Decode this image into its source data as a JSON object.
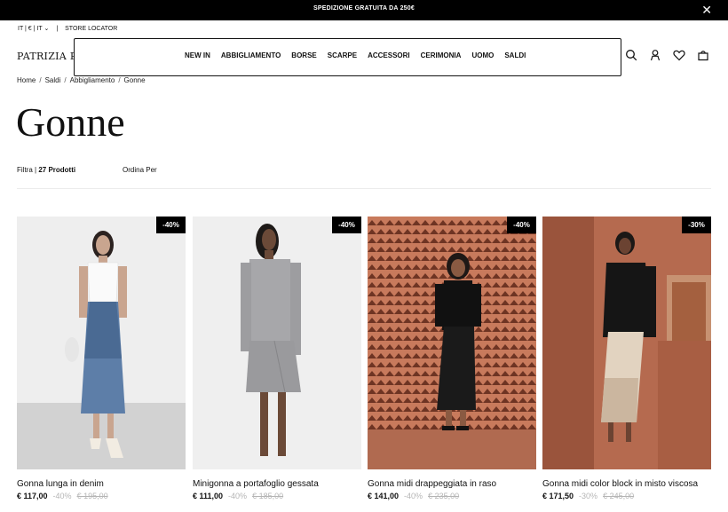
{
  "promo": {
    "text": "SPEDIZIONE GRATUITA DA 250€",
    "close": "✕"
  },
  "locale": {
    "selector": "IT | € | IT ⌄",
    "separator": "|",
    "store_locator": "STORE LOCATOR"
  },
  "brand": {
    "logo": "PATRIZIA PEPE"
  },
  "nav": {
    "items": [
      {
        "label": "NEW IN"
      },
      {
        "label": "ABBIGLIAMENTO"
      },
      {
        "label": "BORSE"
      },
      {
        "label": "SCARPE"
      },
      {
        "label": "ACCESSORI"
      },
      {
        "label": "CERIMONIA"
      },
      {
        "label": "UOMO"
      },
      {
        "label": "SALDI"
      }
    ]
  },
  "header_icons": [
    "search-icon",
    "account-icon",
    "wishlist-heart-icon",
    "shopping-bag-icon"
  ],
  "breadcrumb": [
    {
      "label": "Home"
    },
    {
      "label": "Saldi"
    },
    {
      "label": "Abbigliamento"
    },
    {
      "label": "Gonne"
    }
  ],
  "breadcrumb_separator": "/",
  "page_title": "Gonne",
  "filter": {
    "label": "Filtra",
    "separator": "|",
    "count": "27 Prodotti"
  },
  "sort": {
    "label": "Ordina Per"
  },
  "products": [
    {
      "name": "Gonna lunga in denim",
      "badge": "-40%",
      "price": "€ 117,00",
      "discount": "-40%",
      "old_price": "€ 195,00"
    },
    {
      "name": "Minigonna a portafoglio gessata",
      "badge": "-40%",
      "price": "€ 111,00",
      "discount": "-40%",
      "old_price": "€ 185,00"
    },
    {
      "name": "Gonna midi drappeggiata in raso",
      "badge": "-40%",
      "price": "€ 141,00",
      "discount": "-40%",
      "old_price": "€ 235,00"
    },
    {
      "name": "Gonna midi color block in misto viscosa",
      "badge": "-30%",
      "price": "€ 171,50",
      "discount": "-30%",
      "old_price": "€ 245,00"
    }
  ],
  "colors": {
    "promo_bg": "#000000",
    "badge_bg": "#000000",
    "strike_price": "#b5b5b5"
  }
}
